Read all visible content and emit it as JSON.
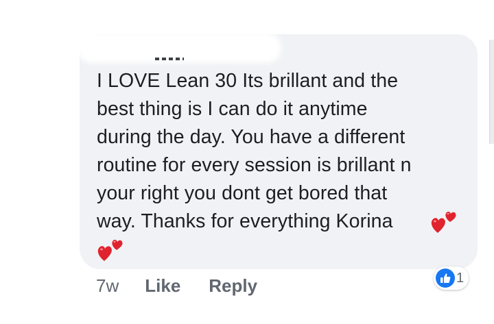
{
  "comment": {
    "author_name": "",
    "text": "I LOVE  Lean 30 Its brillant and the\nbest thing is I can do it anytime\nduring the day.  You have a different\nroutine for every session is brillant n\nyour right you dont get bored that\nway. Thanks for everything Korina",
    "emoji": [
      "two-hearts-icon",
      "two-hearts-icon"
    ]
  },
  "actions": {
    "timestamp": "7w",
    "like_label": "Like",
    "reply_label": "Reply"
  },
  "reactions": {
    "icon": "thumbs-up-icon",
    "count": "1"
  },
  "colors": {
    "bubble_bg": "#f0f2f5",
    "text": "#1c1e21",
    "secondary_text": "#606770",
    "like_blue": "#1877f2",
    "heart_red": "#e0242f"
  }
}
